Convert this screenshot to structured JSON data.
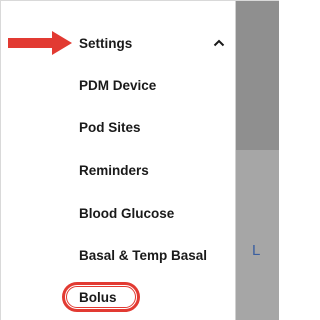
{
  "menu": {
    "settings_label": "Settings",
    "items": [
      {
        "label": "PDM Device"
      },
      {
        "label": "Pod Sites"
      },
      {
        "label": "Reminders"
      },
      {
        "label": "Blood Glucose"
      },
      {
        "label": "Basal & Temp Basal"
      },
      {
        "label": "Bolus"
      }
    ]
  },
  "background": {
    "partial_letter": "L"
  },
  "annotation": {
    "arrow_color": "#e23a32",
    "highlight_color": "#e23a32"
  },
  "icons": {
    "settings_expand": "chevron-up-icon",
    "pointer": "arrow-right-icon"
  }
}
